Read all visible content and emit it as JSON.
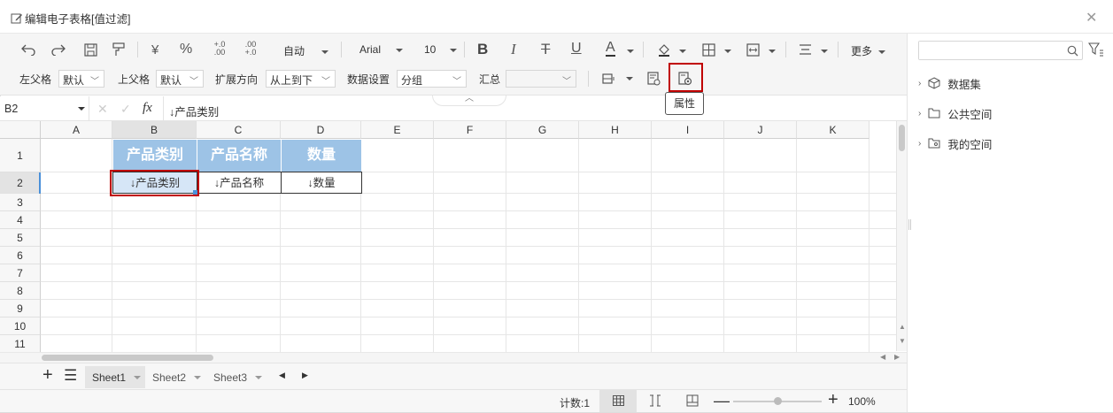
{
  "title": "编辑电子表格[值过滤]",
  "toolbar": {
    "currency": "¥",
    "percent": "%",
    "dec_inc": "+.0\n.00",
    "dec_dec": "-.00\n.0",
    "format": "自动",
    "font": "Arial",
    "size": "10",
    "bold": "B",
    "italic": "I",
    "strike": "T",
    "underline": "U",
    "font_color": "A",
    "more": "更多"
  },
  "toolbar2": {
    "left_parent_label": "左父格",
    "left_parent_value": "默认",
    "top_parent_label": "上父格",
    "top_parent_value": "默认",
    "expand_label": "扩展方向",
    "expand_value": "从上到下",
    "data_label": "数据设置",
    "data_value": "分组",
    "agg_label": "汇总",
    "agg_value": ""
  },
  "tooltip": "属性",
  "formula_bar": {
    "cell": "B2",
    "fx": "fx",
    "content": "↓产品类别"
  },
  "columns": [
    "A",
    "B",
    "C",
    "D",
    "E",
    "F",
    "G",
    "H",
    "I",
    "J",
    "K"
  ],
  "rows": [
    "1",
    "2",
    "3",
    "4",
    "5",
    "6",
    "7",
    "8",
    "9",
    "10",
    "11"
  ],
  "cells": {
    "B1": "产品类别",
    "C1": "产品名称",
    "D1": "数量",
    "B2": "↓产品类别",
    "C2": "↓产品名称",
    "D2": "↓数量"
  },
  "sheets": [
    "Sheet1",
    "Sheet2",
    "Sheet3"
  ],
  "status": {
    "count": "计数:1",
    "zoom": "100%",
    "zoom_level": 100
  },
  "right_panel": {
    "search_placeholder": "",
    "items": [
      "数据集",
      "公共空间",
      "我的空间"
    ]
  },
  "colors": {
    "header_fill": "#9dc3e6",
    "selection_border": "#c00000",
    "accent": "#4a90d9"
  }
}
